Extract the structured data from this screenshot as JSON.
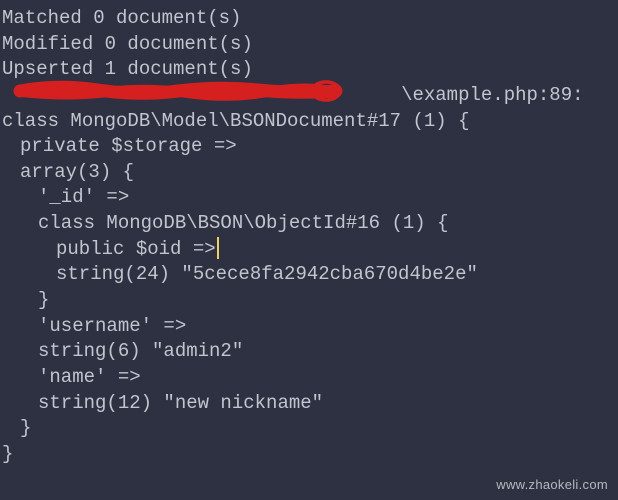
{
  "output": {
    "matched": "Matched 0 document(s)",
    "modified": "Modified 0 document(s)",
    "upserted": "Upserted 1 document(s)",
    "path_prefix_hidden": "",
    "path_suffix": "\\example.php:89:",
    "class_line": "class MongoDB\\Model\\BSONDocument#17 (1) {",
    "storage_line": "private $storage =>",
    "array_open": "array(3) {",
    "id_key": "'_id' =>",
    "oid_class": "class MongoDB\\BSON\\ObjectId#16 (1) {",
    "oid_public": "public $oid =>",
    "oid_string": "string(24) \"5cece8fa2942cba670d4be2e\"",
    "close_brace": "}",
    "username_key": "'username' =>",
    "username_val": "string(6) \"admin2\"",
    "name_key": "'name' =>",
    "name_val": "string(12) \"new nickname\""
  },
  "watermark": "www.zhaokeli.com",
  "colors": {
    "background": "#2d3142",
    "text": "#c0c5ce",
    "redaction": "#d62020",
    "cursor": "#f0d060"
  }
}
